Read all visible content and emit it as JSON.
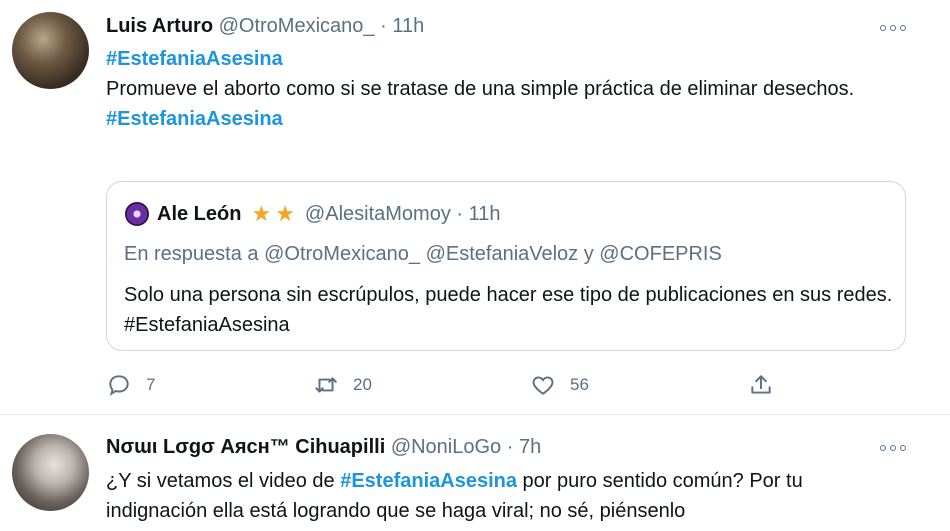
{
  "tweet1": {
    "name": "Luis Arturo",
    "handle": "@OtroMexicano_",
    "dot": "·",
    "time": "11h",
    "hashtag_top": "#EstefaniaAsesina",
    "text": "Promueve el aborto como si se tratase de una simple práctica de eliminar desechos.",
    "hashtag_bottom": "#EstefaniaAsesina",
    "quote": {
      "name": "Ale León",
      "stars": [
        "★",
        "★"
      ],
      "handle": "@AlesitaMomoy",
      "dot": "·",
      "time": "11h",
      "reply_to": "En respuesta a @OtroMexicano_ @EstefaniaVeloz y @COFEPRIS",
      "text": "Solo una persona sin escrúpulos, puede hacer ese tipo de publicaciones en sus redes.  #EstefaniaAsesina"
    },
    "actions": {
      "reply_count": "7",
      "retweet_count": "20",
      "like_count": "56",
      "reply_icon": "comment-icon",
      "retweet_icon": "retweet-icon",
      "like_icon": "heart-icon",
      "share_icon": "share-icon"
    }
  },
  "tweet2": {
    "name": "Nσɯι Lσgσ Aяcн™ Cihuapilli",
    "handle": "@NoniLoGo",
    "dot": "·",
    "time": "7h",
    "text_before": "¿Y si vetamos el video de ",
    "hashtag": "#EstefaniaAsesina",
    "text_after": " por puro sentido  común? Por tu indignación ella está logrando que se haga viral; no sé, piénsenlo"
  },
  "colors": {
    "hashtag": "#1b95e0",
    "secondary_text": "#5b7083",
    "border": "#cfd9de",
    "star": "#f5a623"
  }
}
